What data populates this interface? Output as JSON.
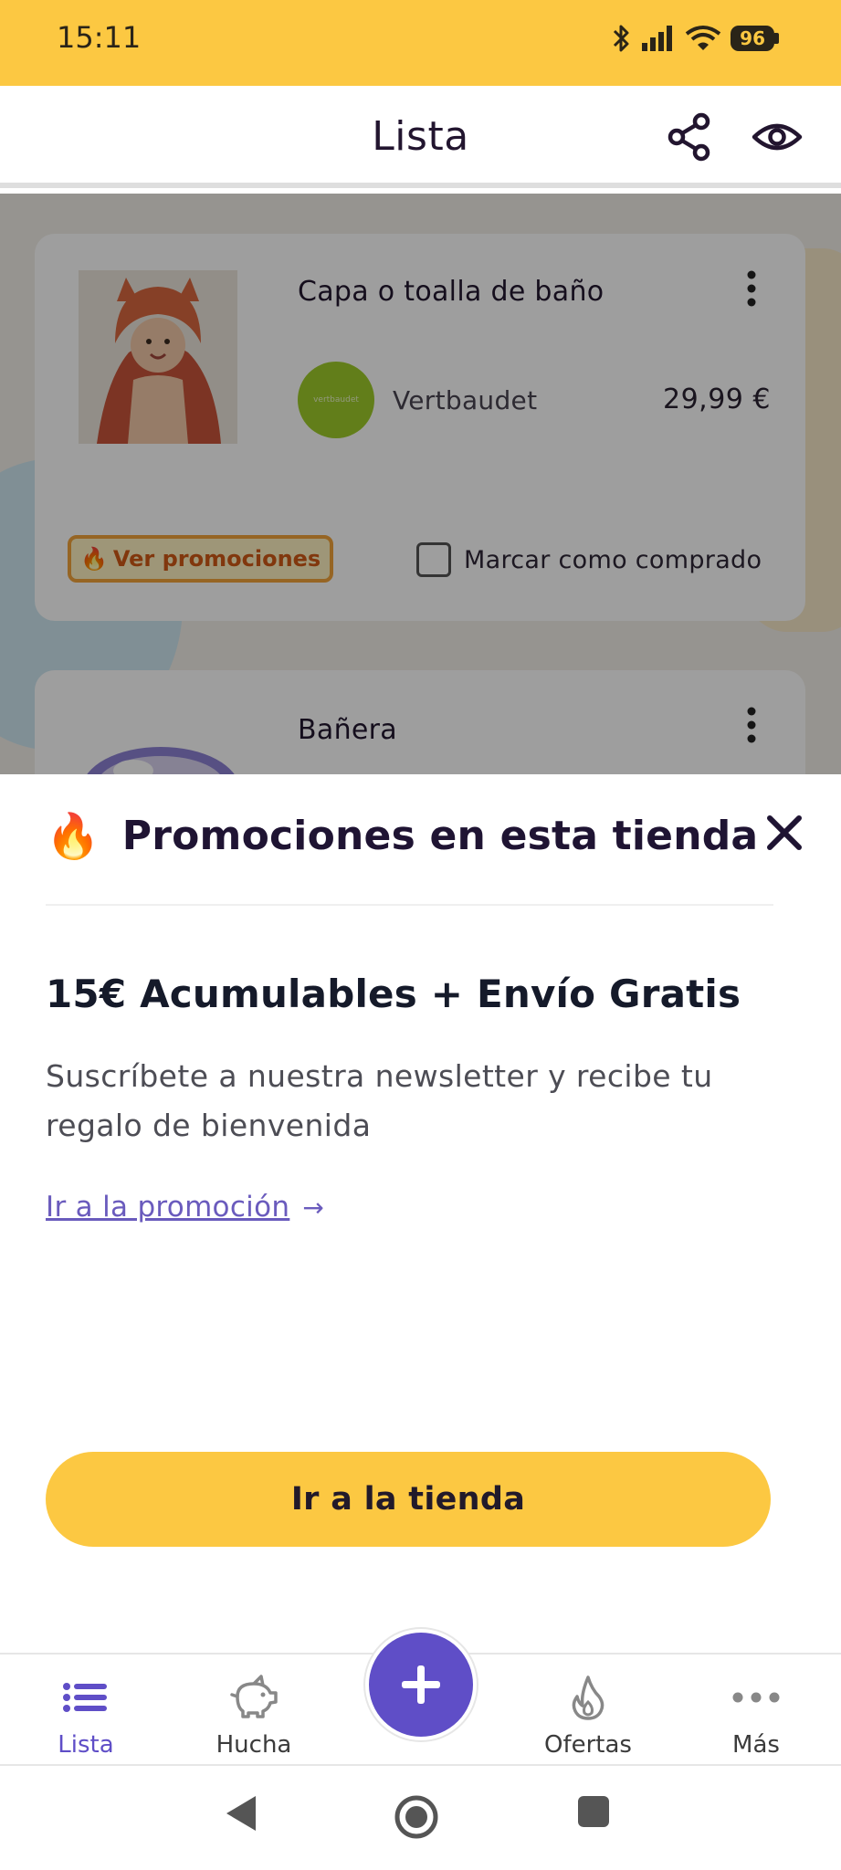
{
  "status_bar": {
    "time": "15:11",
    "battery": "96",
    "icons": [
      "bluetooth-icon",
      "signal-icon",
      "wifi-icon",
      "battery-icon"
    ],
    "background": "#fcc842"
  },
  "app_bar": {
    "title": "Lista",
    "actions": [
      "share-icon",
      "eye-icon"
    ]
  },
  "list": {
    "items": [
      {
        "name": "Capa o toalla de baño",
        "store": "Vertbaudet",
        "store_logo_text": "vertbaudet",
        "price": "29,99 €",
        "promo_label": "Ver promociones",
        "bought_label": "Marcar como comprado"
      },
      {
        "name": "Bañera"
      }
    ]
  },
  "sheet": {
    "title": "Promociones en esta tienda",
    "promo_heading": "15€ Acumulables + Envío Gratis",
    "promo_description": "Suscríbete a nuestra newsletter y recibe tu regalo de bienvenida",
    "promo_link": "Ir a la promoción",
    "promo_link_arrow": "→",
    "store_button": "Ir a la tienda"
  },
  "bottom_nav": {
    "items": [
      {
        "label": "Lista",
        "icon": "list-icon",
        "active": true
      },
      {
        "label": "Hucha",
        "icon": "piggy-bank-icon",
        "active": false
      },
      {
        "label": "Ofertas",
        "icon": "flame-icon",
        "active": false
      },
      {
        "label": "Más",
        "icon": "more-dots-icon",
        "active": false
      }
    ],
    "fab_icon": "plus-icon"
  },
  "colors": {
    "accent_yellow": "#fcc842",
    "accent_purple": "#5f4ec7",
    "link_purple": "#6a5bbd",
    "promo_orange": "#d05a16"
  }
}
